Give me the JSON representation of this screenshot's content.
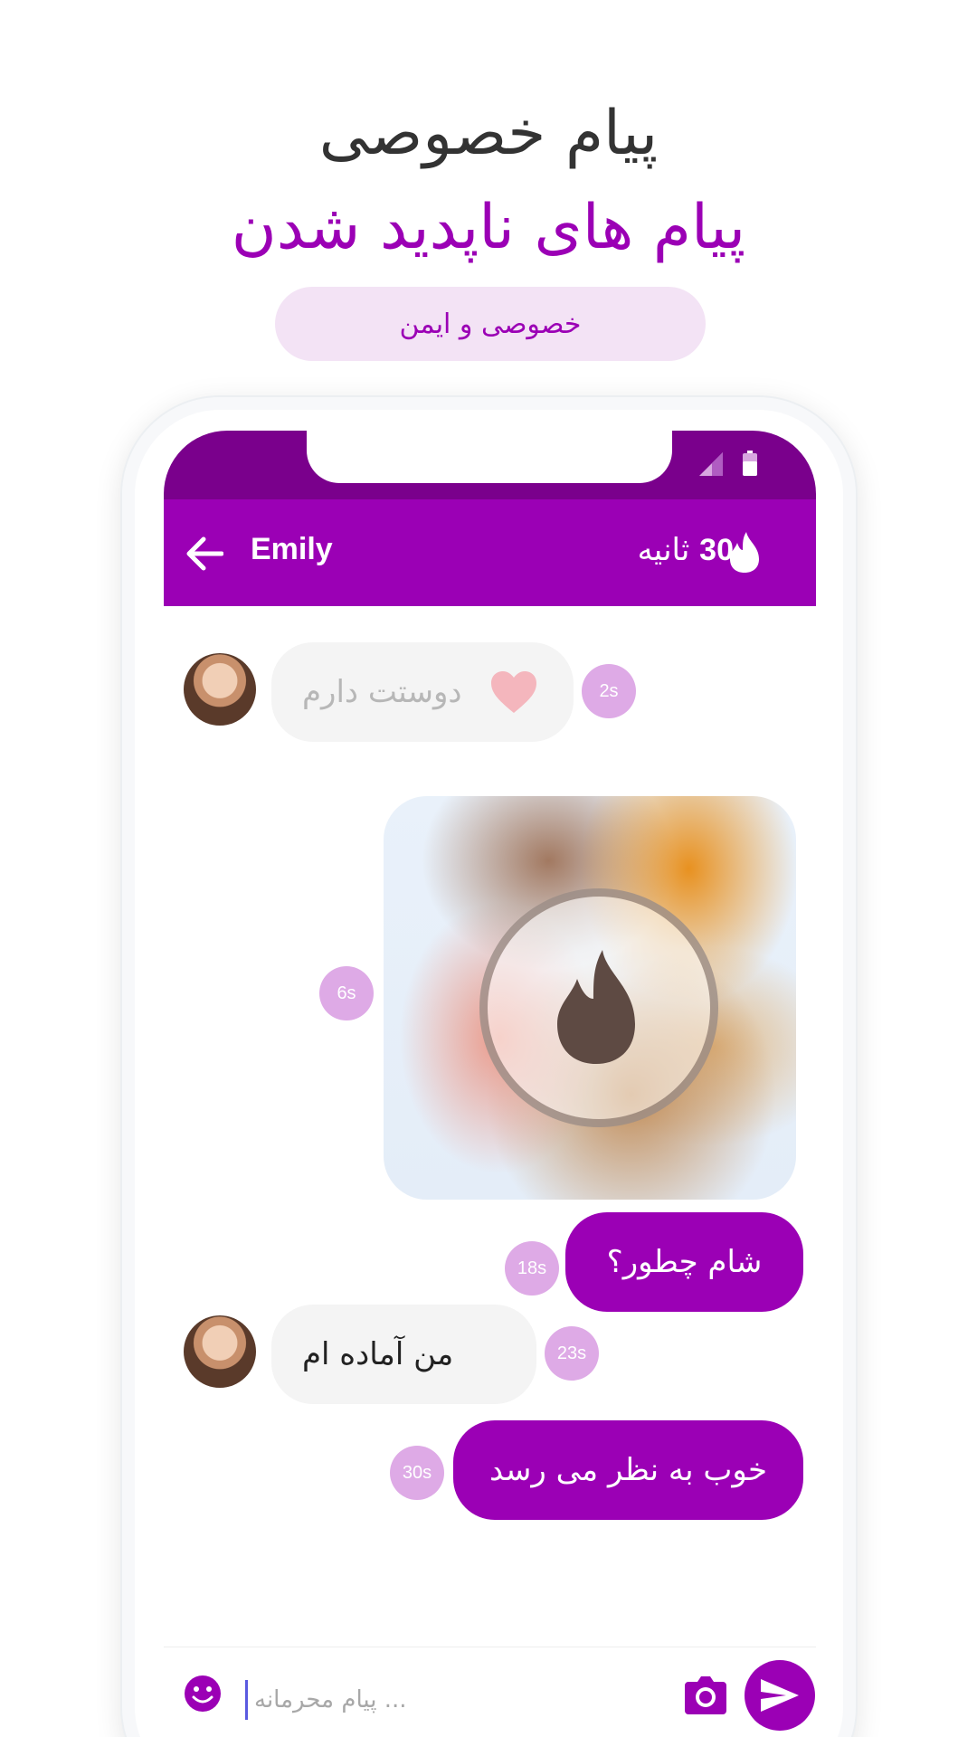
{
  "promo": {
    "headline_1": "پیام خصوصی",
    "headline_2": "پیام های ناپدید شدن",
    "pill": "خصوصی و ایمن"
  },
  "chat_header": {
    "contact_name": "Emily",
    "timer_text": "ثانیه",
    "timer_value": "30"
  },
  "messages": [
    {
      "id": "m1",
      "direction": "incoming",
      "text": "دوستت دارم",
      "time": "2s",
      "faded": true,
      "icon": "heart-icon"
    },
    {
      "id": "m2",
      "direction": "outgoing",
      "type": "media",
      "time": "6s",
      "icon": "flame-icon"
    },
    {
      "id": "m3",
      "direction": "outgoing",
      "text": "شام چطور؟",
      "time": "18s"
    },
    {
      "id": "m4",
      "direction": "incoming",
      "text": "من آماده ام",
      "time": "23s"
    },
    {
      "id": "m5",
      "direction": "outgoing",
      "text": "خوب به نظر می رسد",
      "time": "30s"
    }
  ],
  "input": {
    "placeholder": "پیام محرمانه ..."
  },
  "colors": {
    "accent": "#9b00b5",
    "status_bar": "#7a008c",
    "badge": "#deaae6",
    "pill_bg": "#f3e3f5",
    "incoming_bg": "#f4f4f4"
  }
}
